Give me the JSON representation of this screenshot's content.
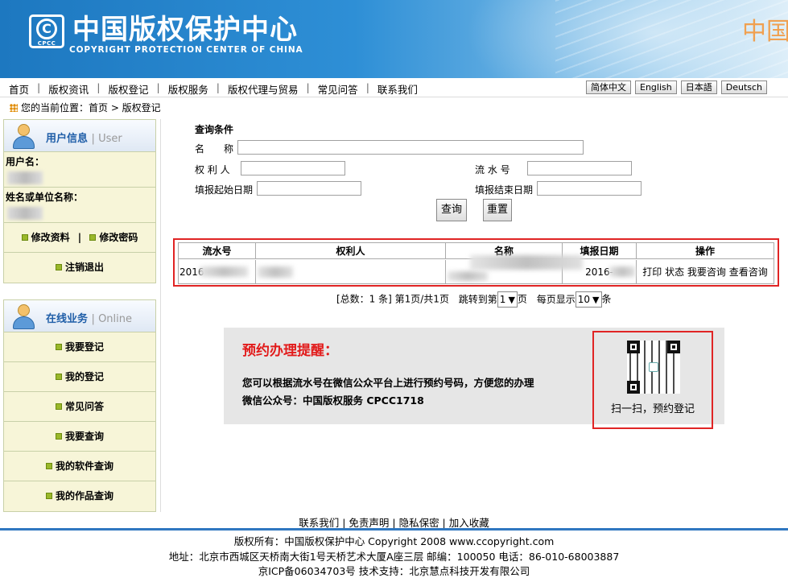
{
  "header": {
    "logo_c": "C",
    "logo_cpcc": "CPCC",
    "title": "中国版权保护中心",
    "subtitle": "COPYRIGHT PROTECTION CENTER OF CHINA",
    "right_text": "中国"
  },
  "nav": {
    "items": [
      "首页",
      "版权资讯",
      "版权登记",
      "版权服务",
      "版权代理与贸易",
      "常见问答",
      "联系我们"
    ],
    "languages": [
      "简体中文",
      "English",
      "日本語",
      "Deutsch"
    ]
  },
  "breadcrumb": "您的当前位置：首页 > 版权登记",
  "user_panel": {
    "title": "用户信息",
    "title_en": "User",
    "username_label": "用户名：",
    "name_label": "姓名或单位名称：",
    "links": [
      "修改资料",
      "修改密码"
    ],
    "link_sep": "|",
    "logout": "注销退出"
  },
  "online_panel": {
    "title": "在线业务",
    "title_en": "Online",
    "items": [
      "我要登记",
      "我的登记",
      "常见问答",
      "我要查询",
      "我的软件查询",
      "我的作品查询"
    ]
  },
  "search": {
    "caption": "查询条件",
    "name_label": "名　　称",
    "owner_label": "权 利 人",
    "serial_label": "流 水 号",
    "start_label": "填报起始日期",
    "end_label": "填报结束日期",
    "query_button": "查询",
    "reset_button": "重置"
  },
  "results": {
    "columns": [
      "流水号",
      "权利人",
      "名称",
      "填报日期",
      "操作"
    ],
    "row": {
      "serial": "2016",
      "date": "2016-",
      "actions": [
        "打印",
        "状态",
        "我要咨询",
        "查看咨询"
      ]
    }
  },
  "pager": {
    "summary": "[总数：1 条] 第1页/共1页",
    "jump_label": "跳转到第",
    "page_value": "1",
    "page_suffix": "页",
    "per_page_label": "每页显示",
    "per_page_value": "10",
    "per_page_suffix": "条"
  },
  "notice": {
    "title": "预约办理提醒：",
    "line1": "您可以根据流水号在微信公众平台上进行预约号码，方便您的办理",
    "line2": "微信公众号：中国版权服务 CPCC1718",
    "qr_caption": "扫一扫，预约登记"
  },
  "footer": {
    "links": "联系我们 | 免责声明 | 隐私保密 | 加入收藏",
    "copyright": "版权所有：中国版权保护中心 Copyright 2008 www.ccopyright.com",
    "address": "地址：北京市西城区天桥南大街1号天桥艺术大厦A座三层 邮编：100050 电话：86-010-68003887",
    "icp": "京ICP备06034703号 技术支持：北京慧点科技开发有限公司"
  },
  "colors": {
    "header_blue": "#2e8fd6",
    "highlight_red": "#e02424",
    "notice_title": "#e21b1b",
    "panel_title": "#1f5ea8",
    "panel_bg": "#f7f5d8"
  }
}
